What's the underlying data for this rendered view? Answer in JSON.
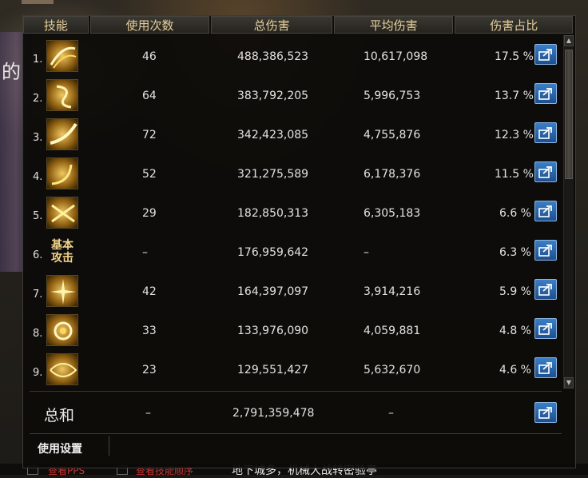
{
  "header": {
    "skill": "技能",
    "uses": "使用次数",
    "total": "总伤害",
    "avg": "平均伤害",
    "pct": "伤害占比"
  },
  "rows": [
    {
      "rank": "1.",
      "uses": "46",
      "total": "488,386,523",
      "avg": "10,617,098",
      "pct": "17.5 %",
      "icon": "slash-burst-icon"
    },
    {
      "rank": "2.",
      "uses": "64",
      "total": "383,792,205",
      "avg": "5,996,753",
      "pct": "13.7 %",
      "icon": "swirl-figure-icon"
    },
    {
      "rank": "3.",
      "uses": "72",
      "total": "342,423,085",
      "avg": "4,755,876",
      "pct": "12.3 %",
      "icon": "crescent-slash-icon"
    },
    {
      "rank": "4.",
      "uses": "52",
      "total": "321,275,589",
      "avg": "6,178,376",
      "pct": "11.5 %",
      "icon": "wave-slash-icon"
    },
    {
      "rank": "5.",
      "uses": "29",
      "total": "182,850,313",
      "avg": "6,305,183",
      "pct": "6.6 %",
      "icon": "cross-slash-icon"
    },
    {
      "rank": "6.",
      "uses": "–",
      "total": "176,959,642",
      "avg": "–",
      "pct": "6.3 %",
      "icon": "basic-attack-icon",
      "icon_text": "基本\n攻击"
    },
    {
      "rank": "7.",
      "uses": "42",
      "total": "164,397,097",
      "avg": "3,914,216",
      "pct": "5.9 %",
      "icon": "spark-burst-icon"
    },
    {
      "rank": "8.",
      "uses": "33",
      "total": "133,976,090",
      "avg": "4,059,881",
      "pct": "4.8 %",
      "icon": "spiral-slash-icon"
    },
    {
      "rank": "9.",
      "uses": "23",
      "total": "129,551,427",
      "avg": "5,632,670",
      "pct": "4.6 %",
      "icon": "whirlwind-icon"
    }
  ],
  "summary": {
    "label": "总和",
    "uses": "–",
    "total": "2,791,359,478",
    "avg": "–"
  },
  "settings_label": "使用设置",
  "bottom_bar": {
    "text": "地下城多，机械大战转密验亭",
    "opt1": "查看PPS",
    "opt2": "查看技能顺序"
  },
  "background_fragment": "的",
  "colors": {
    "header_text": "#e6cf9a",
    "share_button": "#2a66ad",
    "panel_bg": "#0c0b09"
  }
}
